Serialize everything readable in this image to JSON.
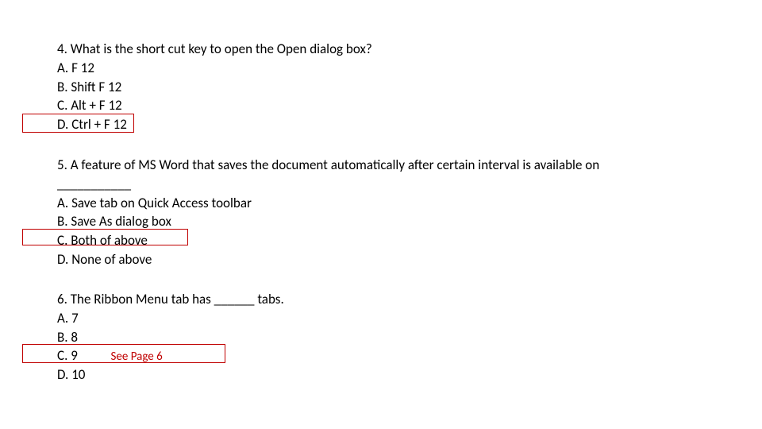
{
  "q4": {
    "question": "4. What is the short cut key to open the Open dialog box?",
    "a": "A. F 12",
    "b": "B. Shift F 12",
    "c": "C. Alt + F 12",
    "d": "D. Ctrl + F 12"
  },
  "q5": {
    "question": "5. A feature of MS Word that saves the document automatically after certain interval is available on",
    "blank": "___________",
    "a": "A. Save tab on Quick Access toolbar",
    "b": "B. Save As dialog box",
    "c": "C. Both of above",
    "d": "D. None of above"
  },
  "q6": {
    "question": "6. The Ribbon Menu tab has ______ tabs.",
    "a": "A. 7",
    "b": "B. 8",
    "c": "C. 9",
    "d": "D. 10",
    "note": "See Page 6"
  }
}
